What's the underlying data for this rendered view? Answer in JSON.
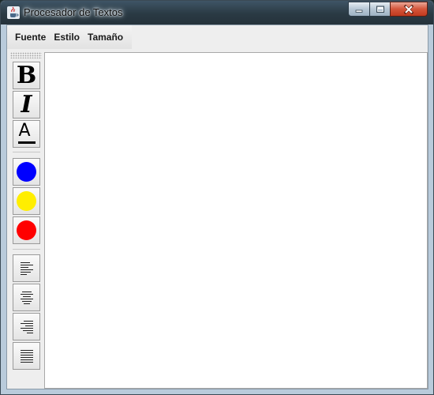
{
  "window": {
    "title": "Procesador de Textos",
    "app_icon": "java-cup-icon",
    "caption_buttons": [
      "minimize-icon",
      "maximize-icon",
      "close-icon"
    ]
  },
  "menubar": {
    "items": [
      {
        "label": "Fuente"
      },
      {
        "label": "Estilo"
      },
      {
        "label": "Tamaño"
      }
    ]
  },
  "toolbar": {
    "style_buttons": [
      {
        "glyph": "B",
        "icon": "bold-icon"
      },
      {
        "glyph": "I",
        "icon": "italic-icon"
      },
      {
        "glyph": "A",
        "icon": "underline-icon"
      }
    ],
    "color_buttons": [
      {
        "icon": "blue-color-icon",
        "color": "#0000ff"
      },
      {
        "icon": "yellow-color-icon",
        "color": "#ffee00"
      },
      {
        "icon": "red-color-icon",
        "color": "#ff0000"
      }
    ],
    "align_buttons": [
      {
        "icon": "align-left-icon"
      },
      {
        "icon": "align-center-icon"
      },
      {
        "icon": "align-right-icon"
      },
      {
        "icon": "align-justify-icon"
      }
    ]
  },
  "editor": {
    "content": ""
  }
}
